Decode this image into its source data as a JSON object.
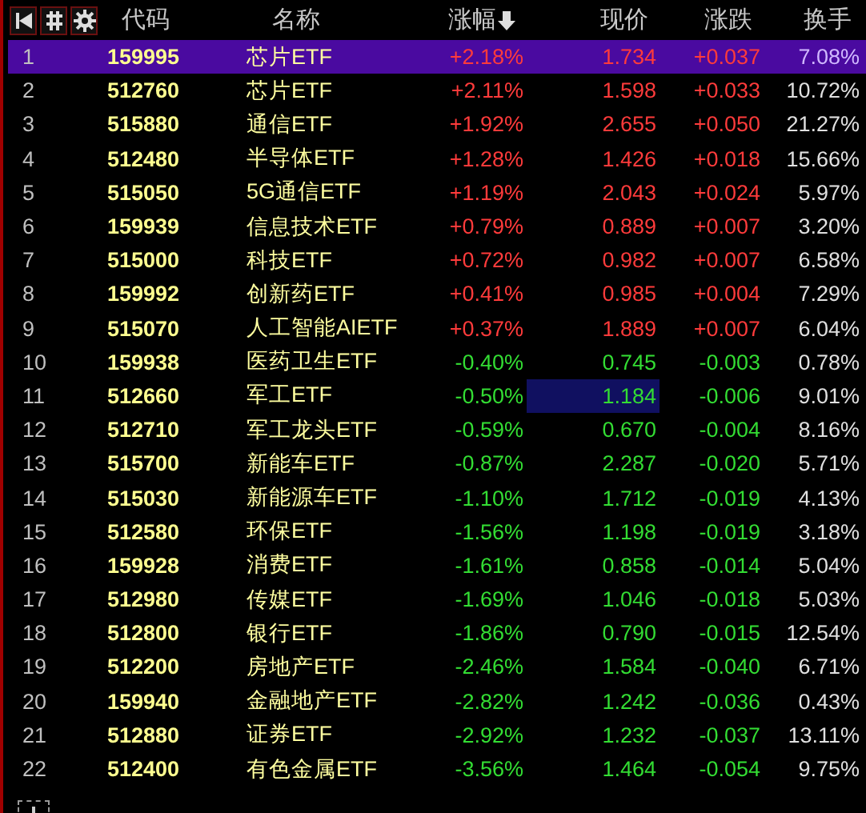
{
  "columns": [
    {
      "label": "代码",
      "sorted": false
    },
    {
      "label": "名称",
      "sorted": false
    },
    {
      "label": "涨幅",
      "sorted": true
    },
    {
      "label": "现价",
      "sorted": false
    },
    {
      "label": "涨跌",
      "sorted": false
    },
    {
      "label": "换手",
      "sorted": false
    }
  ],
  "rows": [
    {
      "index": "1",
      "code": "159995",
      "name": "芯片ETF",
      "change_pct": "+2.18%",
      "price": "1.734",
      "change": "+0.037",
      "turnover": "7.08%",
      "kind": "up",
      "selected": true,
      "price_highlighted": false
    },
    {
      "index": "2",
      "code": "512760",
      "name": "芯片ETF",
      "change_pct": "+2.11%",
      "price": "1.598",
      "change": "+0.033",
      "turnover": "10.72%",
      "kind": "up",
      "selected": false,
      "price_highlighted": false
    },
    {
      "index": "3",
      "code": "515880",
      "name": "通信ETF",
      "change_pct": "+1.92%",
      "price": "2.655",
      "change": "+0.050",
      "turnover": "21.27%",
      "kind": "up",
      "selected": false,
      "price_highlighted": false
    },
    {
      "index": "4",
      "code": "512480",
      "name": "半导体ETF",
      "change_pct": "+1.28%",
      "price": "1.426",
      "change": "+0.018",
      "turnover": "15.66%",
      "kind": "up",
      "selected": false,
      "price_highlighted": false
    },
    {
      "index": "5",
      "code": "515050",
      "name": "5G通信ETF",
      "change_pct": "+1.19%",
      "price": "2.043",
      "change": "+0.024",
      "turnover": "5.97%",
      "kind": "up",
      "selected": false,
      "price_highlighted": false
    },
    {
      "index": "6",
      "code": "159939",
      "name": "信息技术ETF",
      "change_pct": "+0.79%",
      "price": "0.889",
      "change": "+0.007",
      "turnover": "3.20%",
      "kind": "up",
      "selected": false,
      "price_highlighted": false
    },
    {
      "index": "7",
      "code": "515000",
      "name": "科技ETF",
      "change_pct": "+0.72%",
      "price": "0.982",
      "change": "+0.007",
      "turnover": "6.58%",
      "kind": "up",
      "selected": false,
      "price_highlighted": false
    },
    {
      "index": "8",
      "code": "159992",
      "name": "创新药ETF",
      "change_pct": "+0.41%",
      "price": "0.985",
      "change": "+0.004",
      "turnover": "7.29%",
      "kind": "up",
      "selected": false,
      "price_highlighted": false
    },
    {
      "index": "9",
      "code": "515070",
      "name": "人工智能AIETF",
      "change_pct": "+0.37%",
      "price": "1.889",
      "change": "+0.007",
      "turnover": "6.04%",
      "kind": "up",
      "selected": false,
      "price_highlighted": false
    },
    {
      "index": "10",
      "code": "159938",
      "name": "医药卫生ETF",
      "change_pct": "-0.40%",
      "price": "0.745",
      "change": "-0.003",
      "turnover": "0.78%",
      "kind": "down",
      "selected": false,
      "price_highlighted": false
    },
    {
      "index": "11",
      "code": "512660",
      "name": "军工ETF",
      "change_pct": "-0.50%",
      "price": "1.184",
      "change": "-0.006",
      "turnover": "9.01%",
      "kind": "down",
      "selected": false,
      "price_highlighted": true
    },
    {
      "index": "12",
      "code": "512710",
      "name": "军工龙头ETF",
      "change_pct": "-0.59%",
      "price": "0.670",
      "change": "-0.004",
      "turnover": "8.16%",
      "kind": "down",
      "selected": false,
      "price_highlighted": false
    },
    {
      "index": "13",
      "code": "515700",
      "name": "新能车ETF",
      "change_pct": "-0.87%",
      "price": "2.287",
      "change": "-0.020",
      "turnover": "5.71%",
      "kind": "down",
      "selected": false,
      "price_highlighted": false
    },
    {
      "index": "14",
      "code": "515030",
      "name": "新能源车ETF",
      "change_pct": "-1.10%",
      "price": "1.712",
      "change": "-0.019",
      "turnover": "4.13%",
      "kind": "down",
      "selected": false,
      "price_highlighted": false
    },
    {
      "index": "15",
      "code": "512580",
      "name": "环保ETF",
      "change_pct": "-1.56%",
      "price": "1.198",
      "change": "-0.019",
      "turnover": "3.18%",
      "kind": "down",
      "selected": false,
      "price_highlighted": false
    },
    {
      "index": "16",
      "code": "159928",
      "name": "消费ETF",
      "change_pct": "-1.61%",
      "price": "0.858",
      "change": "-0.014",
      "turnover": "5.04%",
      "kind": "down",
      "selected": false,
      "price_highlighted": false
    },
    {
      "index": "17",
      "code": "512980",
      "name": "传媒ETF",
      "change_pct": "-1.69%",
      "price": "1.046",
      "change": "-0.018",
      "turnover": "5.03%",
      "kind": "down",
      "selected": false,
      "price_highlighted": false
    },
    {
      "index": "18",
      "code": "512800",
      "name": "银行ETF",
      "change_pct": "-1.86%",
      "price": "0.790",
      "change": "-0.015",
      "turnover": "12.54%",
      "kind": "down",
      "selected": false,
      "price_highlighted": false
    },
    {
      "index": "19",
      "code": "512200",
      "name": "房地产ETF",
      "change_pct": "-2.46%",
      "price": "1.584",
      "change": "-0.040",
      "turnover": "6.71%",
      "kind": "down",
      "selected": false,
      "price_highlighted": false
    },
    {
      "index": "20",
      "code": "159940",
      "name": "金融地产ETF",
      "change_pct": "-2.82%",
      "price": "1.242",
      "change": "-0.036",
      "turnover": "0.43%",
      "kind": "down",
      "selected": false,
      "price_highlighted": false
    },
    {
      "index": "21",
      "code": "512880",
      "name": "证券ETF",
      "change_pct": "-2.92%",
      "price": "1.232",
      "change": "-0.037",
      "turnover": "13.11%",
      "kind": "down",
      "selected": false,
      "price_highlighted": false
    },
    {
      "index": "22",
      "code": "512400",
      "name": "有色金属ETF",
      "change_pct": "-3.56%",
      "price": "1.464",
      "change": "-0.054",
      "turnover": "9.75%",
      "kind": "down",
      "selected": false,
      "price_highlighted": false
    }
  ]
}
